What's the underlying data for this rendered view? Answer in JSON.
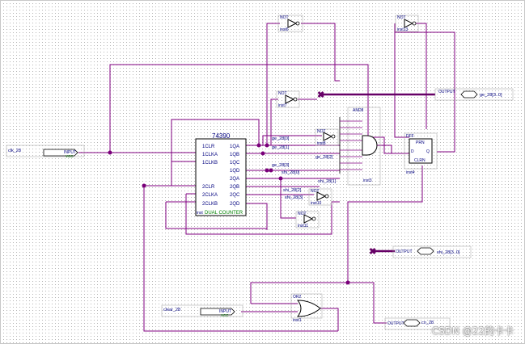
{
  "chip": {
    "part": "74390",
    "name": "DUAL COUNTER",
    "instance": "inst"
  },
  "left_pins": [
    "1CLR",
    "1CLKA",
    "1CLKB",
    "2CLR",
    "2CLKA",
    "2CLKB"
  ],
  "right_pins": [
    "1QA",
    "1QB",
    "1QC",
    "1QD",
    "2QA",
    "2QB",
    "2QC",
    "2QD"
  ],
  "inputs": {
    "clk": {
      "name": "clk_28",
      "kind": "INPUT",
      "sub": "VCC"
    },
    "clear": {
      "name": "clear_28",
      "kind": "INPUT",
      "sub": "VCC"
    }
  },
  "outputs": {
    "ge": {
      "kind": "OUTPUT",
      "name": "ge_28[3..0]"
    },
    "shi": {
      "kind": "OUTPUT",
      "name": "shi_28[3..0]"
    },
    "cn": {
      "kind": "OUTPUT",
      "name": "cn_28"
    }
  },
  "gates": {
    "not_top1": {
      "type": "NOT",
      "inst": "inst6"
    },
    "not_top2": {
      "type": "NOT",
      "inst": "inst13"
    },
    "not_mid": {
      "type": "NOT",
      "inst": "inst7"
    },
    "not_a": {
      "type": "NOT",
      "inst": "inst8"
    },
    "not_b": {
      "type": "NOT",
      "inst": "inst10"
    },
    "not_c": {
      "type": "NOT",
      "inst": "inst11"
    },
    "and": {
      "type": "AND8",
      "inst": "inst3"
    },
    "dff": {
      "type": "DFF",
      "inst": "inst4",
      "pins": [
        "PRN",
        "D",
        "Q",
        "CLRN"
      ]
    },
    "or": {
      "type": "OR2",
      "inst": "inst1"
    }
  },
  "net_labels": [
    "ge_28[0]",
    "ge_28[1]",
    "ge_28[2]",
    "ge_28[3]",
    "shi_28[0]",
    "shi_28[1]",
    "shi_28[2]",
    "shi_28[3]"
  ],
  "watermark": "CSDN @22的卡卡",
  "colors": {
    "wire": "#800080",
    "dot": "#7a007a",
    "bus": "#660066",
    "pin_text": "#00007f",
    "symbol": "#000000",
    "port_sub": "#008000",
    "grid": "#b4b4b4"
  }
}
